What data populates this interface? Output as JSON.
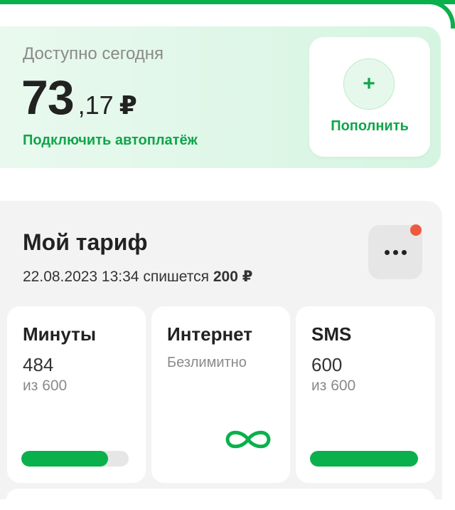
{
  "balance": {
    "label": "Доступно сегодня",
    "amount_int": "73",
    "amount_dec": ",17",
    "currency": "₽",
    "autopay_link": "Подключить автоплатёж",
    "topup_icon": "+",
    "topup_label": "Пополнить"
  },
  "tariff": {
    "title": "Мой тариф",
    "charge_prefix": "22.08.2023 13:34 спишется",
    "charge_amount": "200 ₽",
    "more_icon": "more-dots-icon",
    "tiles": [
      {
        "title": "Минуты",
        "value": "484",
        "sub": "из 600",
        "progress": 0.81
      },
      {
        "title": "Интернет",
        "note": "Безлимитно",
        "icon": "infinity-icon"
      },
      {
        "title": "SMS",
        "value": "600",
        "sub": "из 600",
        "progress": 1.0
      }
    ]
  },
  "colors": {
    "accent": "#0ab04b",
    "accent_text": "#10a54a",
    "notification": "#ee5a3f"
  }
}
